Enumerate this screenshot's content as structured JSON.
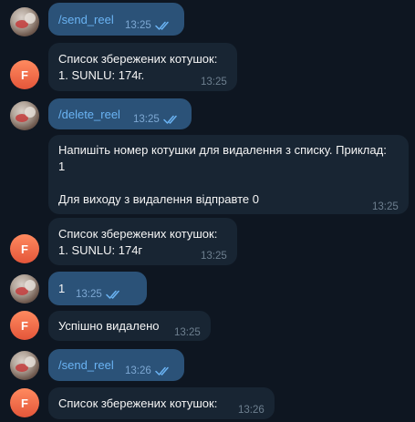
{
  "avatars": {
    "user_letter": "F"
  },
  "messages": [
    {
      "dir": "out",
      "text": "/send_reel",
      "time": "13:25",
      "read": true
    },
    {
      "dir": "in",
      "text": "Список збережених котушок:\n1. SUNLU: 174г.",
      "time": "13:25"
    },
    {
      "dir": "out",
      "text": "/delete_reel",
      "time": "13:25",
      "read": true
    },
    {
      "dir": "in",
      "text": "Напишіть номер котушки для видалення з списку. Приклад:\n1\n\nДля виходу з видалення відправте 0",
      "time": "13:25"
    },
    {
      "dir": "in",
      "text": "Список збережених котушок:\n1. SUNLU: 174г",
      "time": "13:25"
    },
    {
      "dir": "out",
      "text": "1",
      "time": "13:25",
      "read": true
    },
    {
      "dir": "in",
      "text": "Успішно видалено",
      "time": "13:25"
    },
    {
      "dir": "out",
      "text": "/send_reel",
      "time": "13:26",
      "read": true
    },
    {
      "dir": "in",
      "text": "Список збережених котушок:",
      "time": "13:26"
    }
  ],
  "colors": {
    "background": "#0e1621",
    "outgoing_bubble": "#2b5278",
    "incoming_bubble": "#182533",
    "link": "#6ab3f3",
    "read_ticks": "#6ab3f3"
  },
  "icons": {
    "read_receipt": "double-check-icon"
  }
}
